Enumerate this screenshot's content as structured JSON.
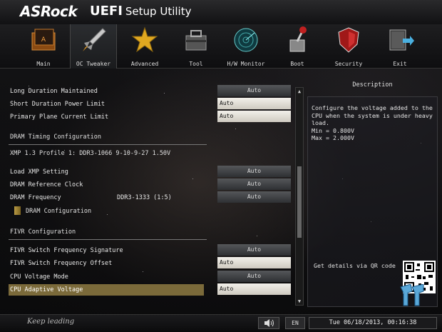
{
  "header": {
    "brand": "ASRock",
    "uefi": "UEFI",
    "subtitle": "Setup Utility"
  },
  "nav": {
    "tabs": [
      {
        "label": "Main",
        "icon": "main-folder-icon"
      },
      {
        "label": "OC Tweaker",
        "icon": "rocket-icon",
        "active": true
      },
      {
        "label": "Advanced",
        "icon": "star-icon"
      },
      {
        "label": "Tool",
        "icon": "toolbox-icon"
      },
      {
        "label": "H/W Monitor",
        "icon": "radar-icon"
      },
      {
        "label": "Boot",
        "icon": "boot-lever-icon"
      },
      {
        "label": "Security",
        "icon": "shield-icon"
      },
      {
        "label": "Exit",
        "icon": "exit-door-icon"
      }
    ]
  },
  "settings": {
    "long_duration_maintained": {
      "label": "Long Duration Maintained",
      "value": "Auto"
    },
    "short_duration_power_limit": {
      "label": "Short Duration Power Limit",
      "value": "Auto"
    },
    "primary_plane_current_limit": {
      "label": "Primary Plane Current Limit",
      "value": "Auto"
    },
    "dram_timing_section": "DRAM Timing Configuration",
    "xmp_profile": "XMP 1.3 Profile 1: DDR3-1066 9-10-9-27 1.50V",
    "load_xmp_setting": {
      "label": "Load XMP Setting",
      "value": "Auto"
    },
    "dram_reference_clock": {
      "label": "DRAM Reference Clock",
      "value": "Auto"
    },
    "dram_frequency": {
      "label": "DRAM Frequency",
      "current": "DDR3-1333 (1:5)",
      "value": "Auto"
    },
    "dram_configuration": "DRAM Configuration",
    "fivr_section": "FIVR Configuration",
    "fivr_switch_freq_signature": {
      "label": "FIVR Switch Frequency Signature",
      "value": "Auto"
    },
    "fivr_switch_freq_offset": {
      "label": "FIVR Switch Frequency Offset",
      "value": "Auto"
    },
    "cpu_voltage_mode": {
      "label": "CPU Voltage Mode",
      "value": "Auto"
    },
    "cpu_adaptive_voltage": {
      "label": "CPU Adaptive Voltage",
      "value": "Auto"
    }
  },
  "description": {
    "title": "Description",
    "line1": "Configure the voltage added to the CPU when the system is under heavy load.",
    "line2": "Min = 0.800V",
    "line3": "Max = 2.000V",
    "qr_label": "Get details via QR code"
  },
  "footer": {
    "tagline": "Keep leading",
    "language": "EN",
    "datetime": "Tue 06/18/2013, 00:16:38"
  },
  "colors": {
    "highlight": "#7b6a3a",
    "accent_text": "#e8e8e8"
  }
}
